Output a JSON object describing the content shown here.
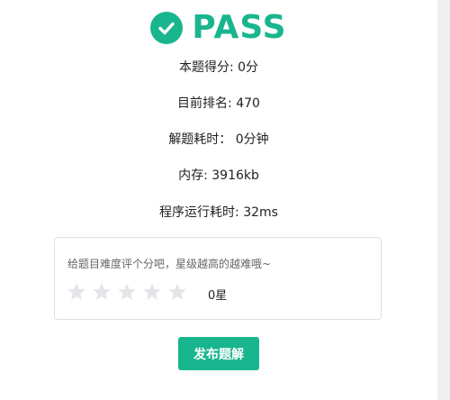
{
  "result": {
    "status": "PASS",
    "icon": "check-circle-icon",
    "accent_color": "#19b58e"
  },
  "stats": {
    "score": {
      "label": "本题得分: ",
      "value": "0分"
    },
    "rank": {
      "label": "目前排名: ",
      "value": "470"
    },
    "solve_time": {
      "label": "解题耗时： ",
      "value": "0分钟"
    },
    "memory": {
      "label": "内存: ",
      "value": "3916kb"
    },
    "run_time": {
      "label": "程序运行耗时: ",
      "value": "32ms"
    }
  },
  "rating": {
    "prompt": "给题目难度评个分吧，星级越高的越难哦~",
    "max_stars": 5,
    "stars_selected": 0,
    "value_label": "0星",
    "star_icon": "star-icon",
    "star_color_empty": "#e3e5e8"
  },
  "actions": {
    "publish_label": "发布题解"
  }
}
